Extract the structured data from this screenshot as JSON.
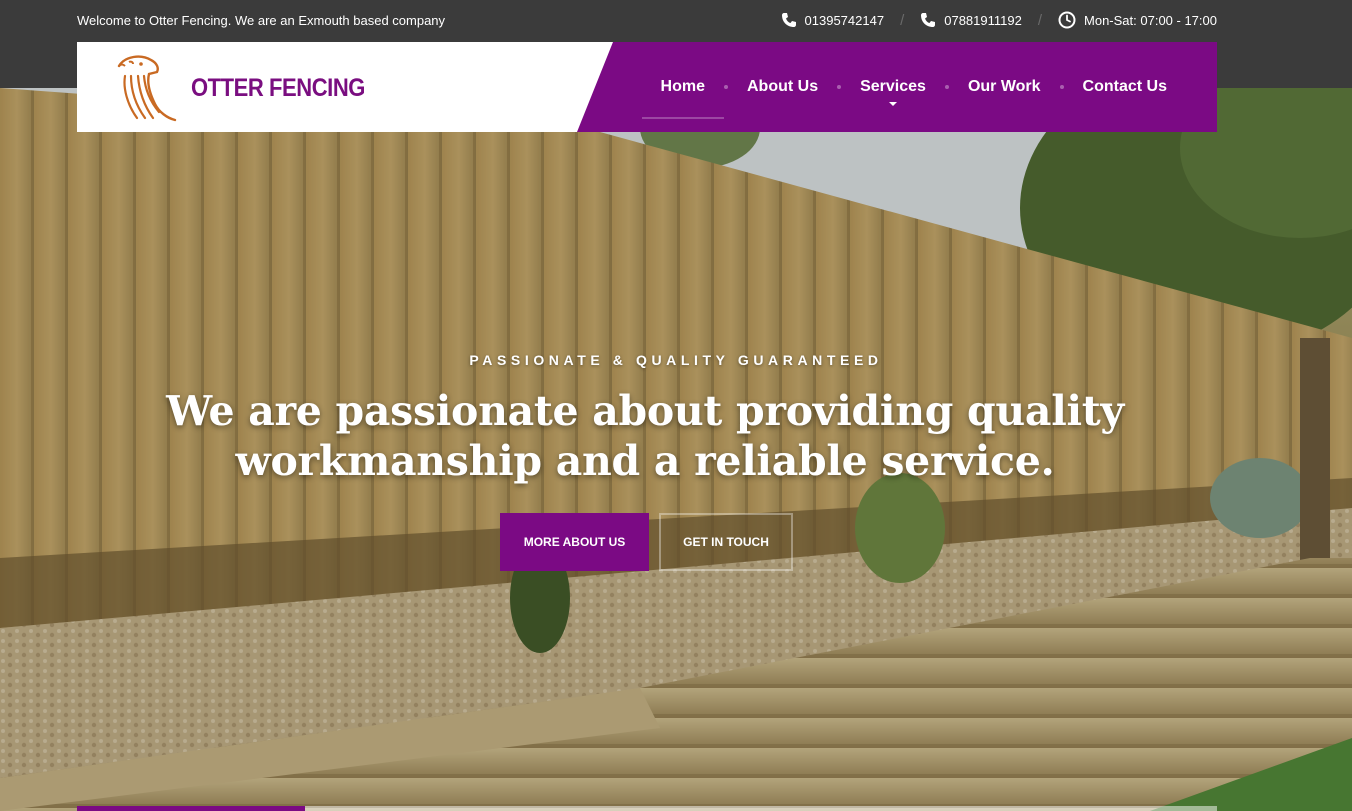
{
  "topbar": {
    "welcome": "Welcome to Otter Fencing. We are an Exmouth based company",
    "phone1": "01395742147",
    "phone2": "07881911192",
    "hours": "Mon-Sat: 07:00 - 17:00",
    "icons": [
      "phone-icon",
      "phone-icon",
      "clock-icon"
    ]
  },
  "header": {
    "brand": "OTTER FENCING",
    "nav": [
      "Home",
      "About Us",
      "Services",
      "Our Work",
      "Contact Us"
    ],
    "active": "Home"
  },
  "hero": {
    "kicker": "PASSIONATE & QUALITY GUARANTEED",
    "headline": "We are passionate about providing quality workmanship and a reliable service.",
    "buttons": {
      "primary": "MORE ABOUT US",
      "secondary": "GET IN TOUCH"
    }
  },
  "colors": {
    "brand_purple": "#7b0a84",
    "topbar": "#3b3b3b",
    "logo_orange": "#c96a23"
  }
}
